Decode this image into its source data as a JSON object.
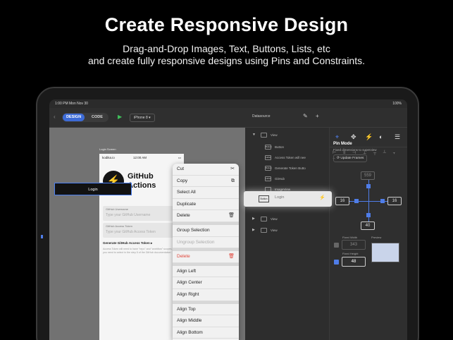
{
  "headline": "Create Responsive Design",
  "subtitle": {
    "line1": "Drag-and-Drop Images, Text, Buttons, Lists, etc",
    "line2": "and create fully responsive designs using Pins and Constraints."
  },
  "status_bar": {
    "time": "1:00 PM  Mon Nov 30",
    "battery": "100%"
  },
  "toolbar": {
    "design_tab": "DESIGN",
    "code_tab": "CODE",
    "device": "iPhone 8",
    "datasource": "Datasource"
  },
  "phone": {
    "screen_title": "Login Screen",
    "carrier": "kodika.io",
    "time": "12:00 AM",
    "app_title_line1": "GitHub",
    "app_title_line2": "Actions",
    "username_label": "GitHub Username",
    "username_placeholder": "Type your GitHub Username",
    "token_label": "GitHub Access Token",
    "token_placeholder": "Type your GitHub Access Token",
    "generate_label": "Generate GitHub Access Token ▸",
    "generate_desc": "Access Token will need to have \"repo\" and \"workflow\" scopes, which you need to select in the step 5 of the GitHub documentation",
    "login_button": "Login"
  },
  "context_menu": {
    "group1": [
      {
        "label": "Cut",
        "icon": "✂",
        "icon_name": "scissors-icon",
        "enabled": true
      },
      {
        "label": "Copy",
        "icon": "⧉",
        "icon_name": "copy-icon",
        "enabled": true
      },
      {
        "label": "Select All",
        "icon": "",
        "icon_name": "",
        "enabled": true
      },
      {
        "label": "Duplicate",
        "icon": "",
        "icon_name": "",
        "enabled": true
      },
      {
        "label": "Delete",
        "icon": "🗑",
        "icon_name": "trash-icon",
        "enabled": true
      }
    ],
    "group2": [
      {
        "label": "Group Selection",
        "enabled": true
      },
      {
        "label": "Ungroup Selection",
        "enabled": false
      }
    ],
    "delete_red": {
      "label": "Delete",
      "icon": "🗑"
    },
    "group3": [
      {
        "label": "Align Left"
      },
      {
        "label": "Align Center"
      },
      {
        "label": "Align Right"
      }
    ],
    "group4": [
      {
        "label": "Align Top"
      },
      {
        "label": "Align Middle"
      },
      {
        "label": "Align Bottom"
      }
    ]
  },
  "layers": {
    "rows": [
      {
        "label": "View",
        "tag": ""
      },
      {
        "label": "Button",
        "tag": "Button"
      },
      {
        "label": "Access Token will nee",
        "tag": "Label"
      },
      {
        "label": "Generate Token Butto",
        "tag": "Button"
      },
      {
        "label": "GitHub",
        "tag": "Label"
      },
      {
        "label": "ImageView",
        "tag": ""
      }
    ],
    "selected": {
      "label": "Login",
      "tag": "Button"
    },
    "rows_after": [
      {
        "label": "View"
      },
      {
        "label": "View"
      }
    ]
  },
  "inspector": {
    "pin_mode_title": "Pin Mode",
    "pin_mode_desc": "Fixed dimensions to superview",
    "update_frames": "Update Frames",
    "pin_top": "559",
    "pin_left": "16",
    "pin_right": "16",
    "pin_bottom": "40",
    "fixed_width_label": "Fixed Width",
    "fixed_width": "343",
    "fixed_height_label": "Fixed Height",
    "fixed_height": "48",
    "preview_label": "Preview"
  },
  "colors": {
    "accent": "#3d6bd6",
    "pin_blue": "#4f7de8",
    "play_green": "#3fbf5a",
    "delete_red": "#e0463b"
  }
}
